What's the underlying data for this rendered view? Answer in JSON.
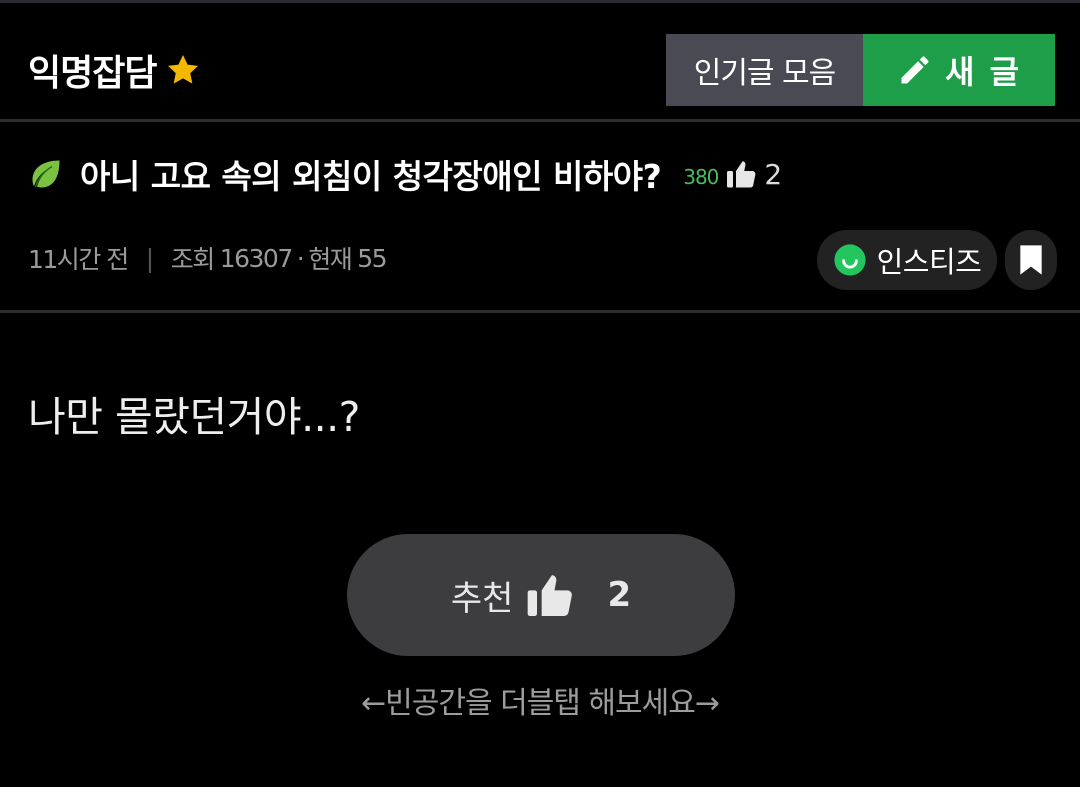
{
  "header": {
    "board_title": "익명잡담",
    "popular_button": "인기글 모음",
    "new_post_button": "새 글"
  },
  "post": {
    "title": "아니 고요 속의 외침이 청각장애인 비하야?",
    "author_level": "380",
    "like_count": "2",
    "time_ago": "11시간 전",
    "separator": "|",
    "views_label": "조회",
    "views": "16307",
    "dot": "·",
    "current_label": "현재",
    "current": "55",
    "author": "인스티즈",
    "body": "나만 몰랐던거야...?"
  },
  "recommend": {
    "label": "추천",
    "count": "2",
    "hint": "←빈공간을 더블탭 해보세요→"
  },
  "colors": {
    "accent_green": "#1f9e4a",
    "level_green": "#4cba60",
    "star": "#f5b800"
  }
}
